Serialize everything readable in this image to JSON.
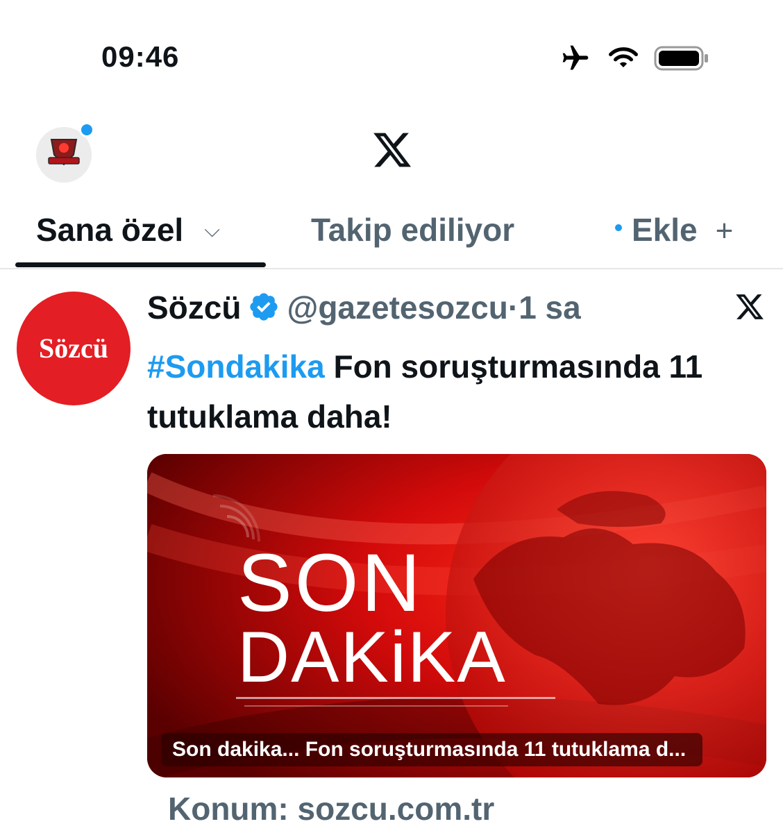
{
  "status_bar": {
    "time": "09:46",
    "icons": [
      "airplane-icon",
      "wifi-icon",
      "battery-icon"
    ]
  },
  "header": {
    "logo_icon": "x-logo-icon",
    "avatar_badge_color": "#1d9bf0"
  },
  "tabs": [
    {
      "label": "Sana özel",
      "active": true
    },
    {
      "label": "Takip ediliyor",
      "active": false
    },
    {
      "label": "Ekle",
      "active": false
    }
  ],
  "post": {
    "avatar_text": "Sözcü",
    "author_name": "Sözcü",
    "handle": "@gazetesozcu",
    "separator": "·",
    "time": "1 sa",
    "hashtag": "#Sondakika",
    "text": "Fon soruşturmasında 11 tutuklama daha!",
    "media": {
      "headline_line1": "SON",
      "headline_line2": "DAKiKA",
      "caption": "Son dakika... Fon soruşturmasında 11 tutuklama d..."
    },
    "source": "Konum: sozcu.com.tr"
  },
  "colors": {
    "accent": "#1d9bf0",
    "brand_red": "#e31e24",
    "text_primary": "#0f1419",
    "text_secondary": "#536471"
  }
}
